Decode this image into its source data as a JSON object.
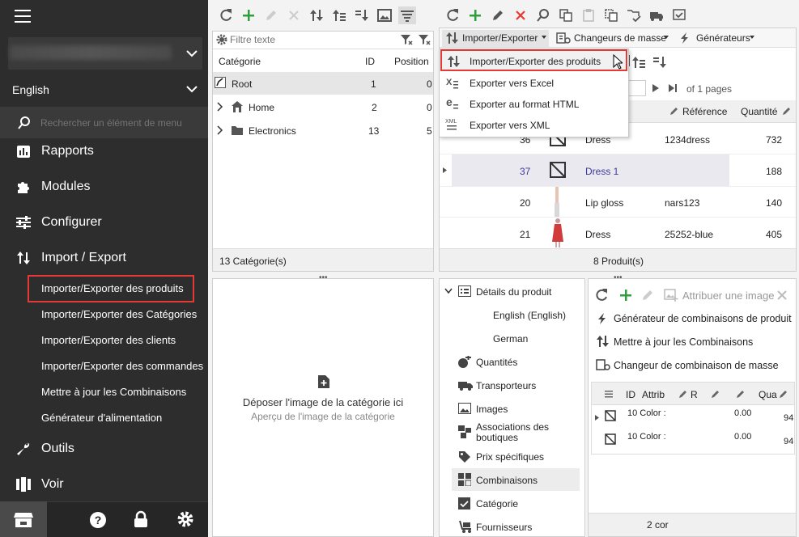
{
  "sidebar": {
    "language": "English",
    "search_placeholder": "Rechercher un élément de menu",
    "items": [
      {
        "label": "Rapports",
        "icon": "reports-icon"
      },
      {
        "label": "Modules",
        "icon": "puzzle-icon"
      },
      {
        "label": "Configurer",
        "icon": "sliders-icon"
      },
      {
        "label": "Import / Export",
        "icon": "import-export-icon"
      }
    ],
    "sub_items": [
      "Importer/Exporter des produits",
      "Importer/Exporter des Catégories",
      "Importer/Exporter des clients",
      "Importer/Exporter des commandes",
      "Mettre à jour les Combinaisons",
      "Générateur d'alimentation"
    ],
    "items2": [
      {
        "label": "Outils",
        "icon": "wrench-icon"
      },
      {
        "label": "Voir",
        "icon": "columns-icon"
      }
    ]
  },
  "categories": {
    "filter_placeholder": "Filtre texte",
    "columns": [
      "Catégorie",
      "ID",
      "Position"
    ],
    "rows": [
      {
        "name": "Root",
        "id": "1",
        "pos": "0"
      },
      {
        "name": "Home",
        "id": "2",
        "pos": "0"
      },
      {
        "name": "Electronics",
        "id": "13",
        "pos": "5"
      }
    ],
    "footer": "13 Catégorie(s)",
    "drop_title": "Déposer l'image de la catégorie ici",
    "drop_sub": "Aperçu de l'image de la catégorie"
  },
  "products": {
    "menu": {
      "import_export": "Importer/Exporter",
      "bulk": "Changeurs de masse",
      "generators": "Générateurs"
    },
    "dropdown": [
      "Importer/Exporter des produits",
      "Exporter vers Excel",
      "Exporter au format HTML",
      "Exporter vers XML"
    ],
    "pager": "of 1 pages",
    "columns": {
      "reference": "Référence",
      "quantity": "Quantité"
    },
    "rows": [
      {
        "id": "36",
        "name": "Dress",
        "ref": "1234dress",
        "qty": "732"
      },
      {
        "id": "37",
        "name": "Dress 1",
        "ref": "",
        "qty": "188"
      },
      {
        "id": "20",
        "name": "Lip gloss",
        "ref": "nars123",
        "qty": "140"
      },
      {
        "id": "21",
        "name": "Dress",
        "ref": "25252-blue",
        "qty": "405"
      }
    ],
    "footer": "8 Produit(s)"
  },
  "details": {
    "root": "Détails du produit",
    "langs": [
      "English (English)",
      "German"
    ],
    "items": [
      "Quantités",
      "Transporteurs",
      "Images",
      "Associations des boutiques",
      "Prix spécifiques",
      "Combinaisons",
      "Catégorie",
      "Fournisseurs"
    ]
  },
  "combos": {
    "assign_image": "Attribuer une image",
    "actions": [
      "Générateur de combinaisons de produit",
      "Mettre à jour les Combinaisons",
      "Changeur de combinaison de masse"
    ],
    "cols": [
      "ID",
      "Attrib",
      "R",
      "Q",
      "Qua"
    ],
    "rows": [
      {
        "attr": "10 Color :",
        "price": "0.00",
        "qty": "94"
      },
      {
        "attr": "10 Color :",
        "price": "0.00",
        "qty": "94"
      }
    ],
    "footer": "2 cor"
  }
}
